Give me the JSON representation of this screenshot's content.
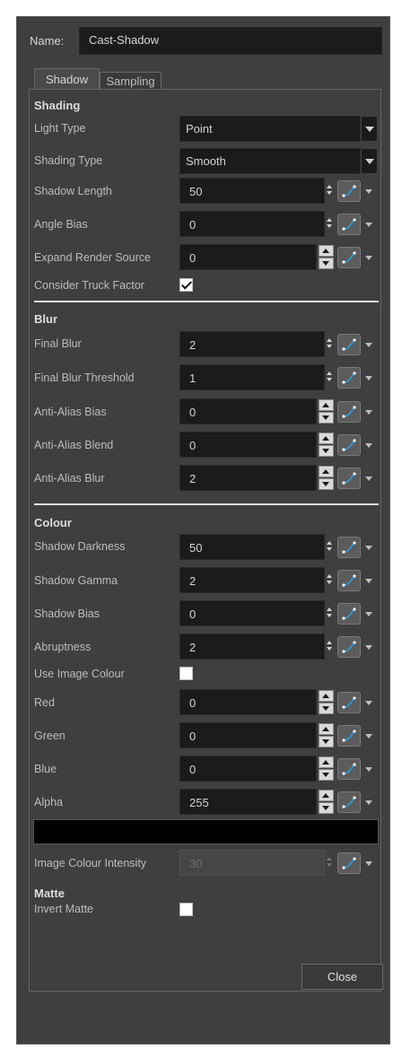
{
  "name": {
    "label": "Name:",
    "value": "Cast-Shadow"
  },
  "tabs": [
    {
      "label": "Shadow",
      "active": true
    },
    {
      "label": "Sampling",
      "active": false
    }
  ],
  "sections": {
    "shading": "Shading",
    "blur": "Blur",
    "colour": "Colour",
    "matte": "Matte"
  },
  "shading": {
    "light_type": {
      "label": "Light Type",
      "value": "Point"
    },
    "shading_type": {
      "label": "Shading Type",
      "value": "Smooth"
    },
    "shadow_length": {
      "label": "Shadow Length",
      "value": "50"
    },
    "angle_bias": {
      "label": "Angle Bias",
      "value": "0"
    },
    "expand_render_source": {
      "label": "Expand Render Source",
      "value": "0"
    },
    "consider_truck_factor": {
      "label": "Consider Truck Factor",
      "checked": true
    }
  },
  "blur": {
    "final_blur": {
      "label": "Final Blur",
      "value": "2"
    },
    "final_blur_threshold": {
      "label": "Final Blur Threshold",
      "value": "1"
    },
    "anti_alias_bias": {
      "label": "Anti-Alias Bias",
      "value": "0"
    },
    "anti_alias_blend": {
      "label": "Anti-Alias Blend",
      "value": "0"
    },
    "anti_alias_blur": {
      "label": "Anti-Alias Blur",
      "value": "2"
    }
  },
  "colour": {
    "shadow_darkness": {
      "label": "Shadow Darkness",
      "value": "50"
    },
    "shadow_gamma": {
      "label": "Shadow Gamma",
      "value": "2"
    },
    "shadow_bias": {
      "label": "Shadow Bias",
      "value": "0"
    },
    "abruptness": {
      "label": "Abruptness",
      "value": "2"
    },
    "use_image_colour": {
      "label": "Use Image Colour",
      "checked": false
    },
    "red": {
      "label": "Red",
      "value": "0"
    },
    "green": {
      "label": "Green",
      "value": "0"
    },
    "blue": {
      "label": "Blue",
      "value": "0"
    },
    "alpha": {
      "label": "Alpha",
      "value": "255"
    },
    "swatch_color": "#000000",
    "image_colour_intensity": {
      "label": "Image Colour Intensity",
      "value": "30"
    }
  },
  "matte": {
    "invert_matte": {
      "label": "Invert Matte",
      "checked": false
    }
  },
  "buttons": {
    "close": "Close"
  },
  "icons": {
    "function": "function-curve-icon",
    "spin": "spin-arrows-icon",
    "dropdown": "dropdown-arrow-icon"
  },
  "colors": {
    "panel_bg": "#3f3f3f",
    "field_bg": "#1b1b1b",
    "fn_curve": "#2aa0e0"
  }
}
